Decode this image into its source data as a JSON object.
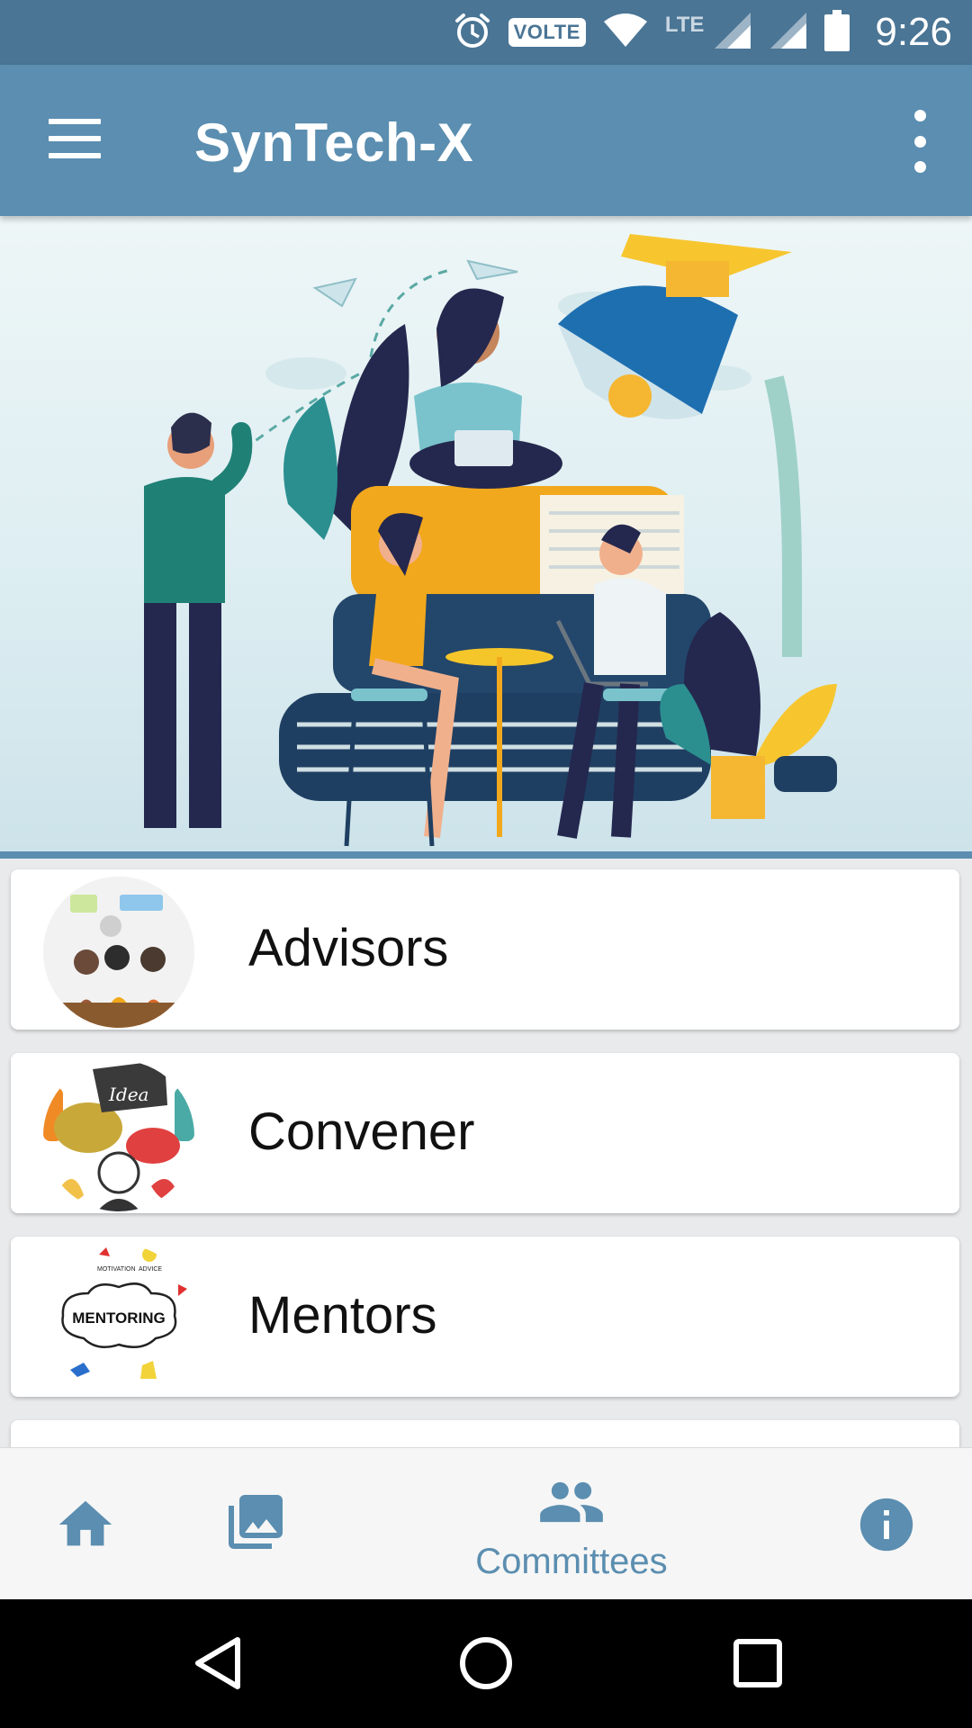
{
  "status_bar": {
    "time": "9:26",
    "volte": "VOLTE",
    "network": "LTE",
    "icons": [
      "alarm-icon",
      "wifi-icon",
      "signal-icon",
      "battery-icon"
    ]
  },
  "app_bar": {
    "title": "SynTech-X",
    "menu_icon": "hamburger-menu-icon",
    "overflow_icon": "more-vertical-icon"
  },
  "hero": {
    "description_icon": "education-illustration"
  },
  "committees": [
    {
      "label": "Advisors",
      "thumb": "audience-illustration"
    },
    {
      "label": "Convener",
      "thumb": "idea-speech-bubbles-illustration"
    },
    {
      "label": "Mentors",
      "thumb": "mentoring-illustration"
    }
  ],
  "mentoring_thumb_text": {
    "center": "MENTORING",
    "motivation": "MOTIVATION",
    "advice": "ADVICE"
  },
  "convener_thumb_text": "Idea",
  "bottom_nav": {
    "items": [
      {
        "icon": "home-icon",
        "label": ""
      },
      {
        "icon": "gallery-icon",
        "label": ""
      },
      {
        "icon": "people-icon",
        "label": "Committees",
        "selected": true
      },
      {
        "icon": "info-icon",
        "label": ""
      }
    ],
    "accent_color": "#5b8eb0"
  },
  "system_nav": {
    "icons": [
      "back-icon",
      "home-circle-icon",
      "recents-icon"
    ]
  },
  "colors": {
    "status_bar": "#4a7595",
    "app_bar": "#5b8eb0",
    "background": "#e9eaec"
  }
}
